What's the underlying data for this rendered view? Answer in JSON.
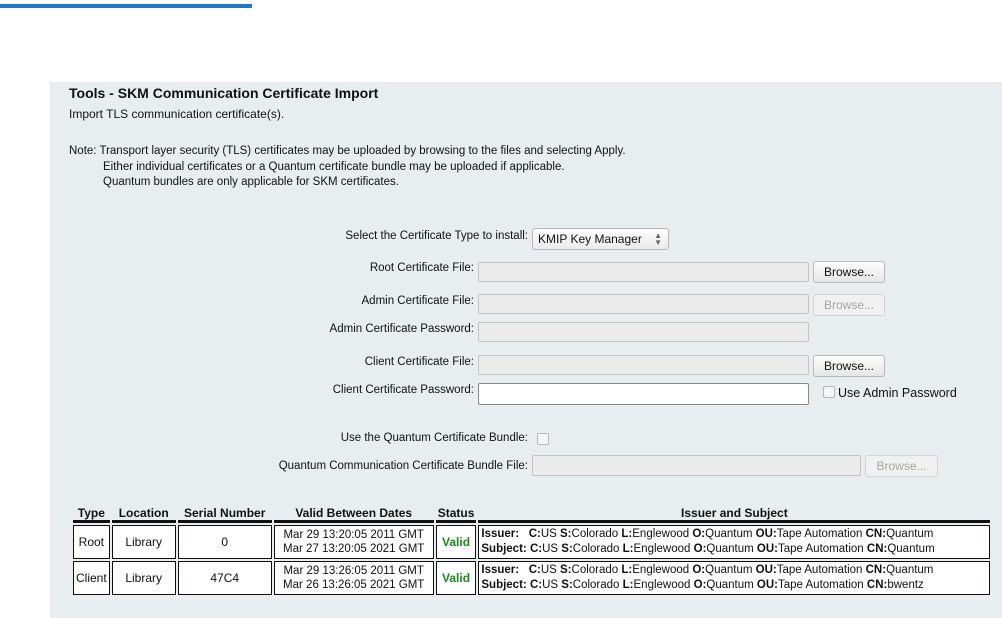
{
  "page": {
    "title": "Tools - SKM Communication Certificate Import",
    "subtitle": "Import TLS communication certificate(s).",
    "note": {
      "line1": "Note: Transport layer security (TLS) certificates may be uploaded by browsing to the files and selecting Apply.",
      "line2": "Either individual certificates or a Quantum certificate bundle may be uploaded if applicable.",
      "line3": "Quantum bundles are only applicable for SKM certificates."
    }
  },
  "form": {
    "cert_type_label": "Select the Certificate Type to install:",
    "cert_type_value": "KMIP Key Manager",
    "root_file_label": "Root Certificate File:",
    "admin_file_label": "Admin Certificate File:",
    "admin_password_label": "Admin Certificate Password:",
    "client_file_label": "Client Certificate File:",
    "client_password_label": "Client Certificate Password:",
    "use_admin_password_label": "Use Admin Password",
    "use_bundle_label": "Use the Quantum Certificate Bundle:",
    "bundle_file_label": "Quantum Communication Certificate Bundle File:",
    "browse_label": "Browse..."
  },
  "table": {
    "headers": [
      "Type",
      "Location",
      "Serial Number",
      "Valid Between Dates",
      "Status",
      "Issuer and Subject"
    ],
    "rows": [
      {
        "type": "Root",
        "location": "Library",
        "serial": "0",
        "date_from": "Mar 29 13:20:05 2011 GMT",
        "date_to": "Mar 27 13:20:05 2021 GMT",
        "status": "Valid",
        "issuer": {
          "prefix": "Issuer:",
          "C": "US",
          "S": "Colorado",
          "L": "Englewood",
          "O": "Quantum",
          "OU": "Tape Automation",
          "CN": "Quantum"
        },
        "subject": {
          "prefix": "Subject:",
          "C": "US",
          "S": "Colorado",
          "L": "Englewood",
          "O": "Quantum",
          "OU": "Tape Automation",
          "CN": "Quantum"
        }
      },
      {
        "type": "Client",
        "location": "Library",
        "serial": "47C4",
        "date_from": "Mar 29 13:26:05 2011 GMT",
        "date_to": "Mar 26 13:26:05 2021 GMT",
        "status": "Valid",
        "issuer": {
          "prefix": "Issuer:",
          "C": "US",
          "S": "Colorado",
          "L": "Englewood",
          "O": "Quantum",
          "OU": "Tape Automation",
          "CN": "Quantum"
        },
        "subject": {
          "prefix": "Subject:",
          "C": "US",
          "S": "Colorado",
          "L": "Englewood",
          "O": "Quantum",
          "OU": "Tape Automation",
          "CN": "bwentz"
        }
      }
    ],
    "field_keys": {
      "C": "C:",
      "S": "S:",
      "L": "L:",
      "O": "O:",
      "OU": "OU:",
      "CN": "CN:"
    }
  },
  "colors": {
    "accent": "#1f78c8",
    "valid": "#1c8a1c",
    "panel": "#e8eef0"
  }
}
